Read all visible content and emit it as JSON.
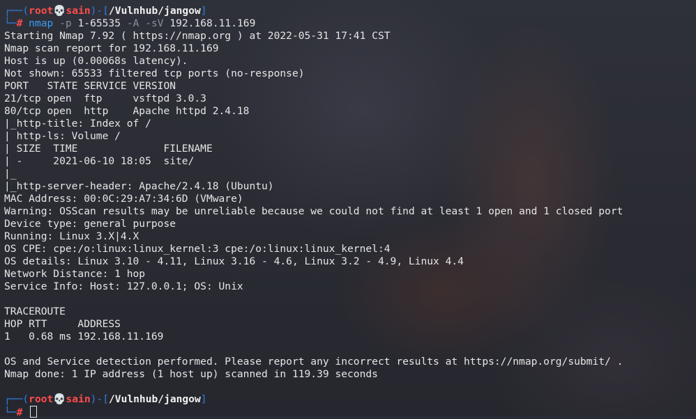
{
  "prompt": {
    "corner_top": "┌──(",
    "user": "root",
    "skull": "💀",
    "host": "sain",
    "mid": ")-[",
    "path": "/Vulnhub/jangow",
    "end": "]",
    "corner_bottom": "└─",
    "symbol": "#"
  },
  "command": {
    "program": "nmap",
    "flag_p": "-p",
    "port_range": "1-65535",
    "flag_A": "-A",
    "flag_sV": "-sV",
    "target": "192.168.11.169"
  },
  "output": [
    "Starting Nmap 7.92 ( https://nmap.org ) at 2022-05-31 17:41 CST",
    "Nmap scan report for 192.168.11.169",
    "Host is up (0.00068s latency).",
    "Not shown: 65533 filtered tcp ports (no-response)",
    "PORT   STATE SERVICE VERSION",
    "21/tcp open  ftp     vsftpd 3.0.3",
    "80/tcp open  http    Apache httpd 2.4.18",
    "|_http-title: Index of /",
    "| http-ls: Volume /",
    "| SIZE  TIME              FILENAME",
    "| -     2021-06-10 18:05  site/",
    "|_",
    "|_http-server-header: Apache/2.4.18 (Ubuntu)",
    "MAC Address: 00:0C:29:A7:34:6D (VMware)",
    "Warning: OSScan results may be unreliable because we could not find at least 1 open and 1 closed port",
    "Device type: general purpose",
    "Running: Linux 3.X|4.X",
    "OS CPE: cpe:/o:linux:linux_kernel:3 cpe:/o:linux:linux_kernel:4",
    "OS details: Linux 3.10 - 4.11, Linux 3.16 - 4.6, Linux 3.2 - 4.9, Linux 4.4",
    "Network Distance: 1 hop",
    "Service Info: Host: 127.0.0.1; OS: Unix",
    "",
    "TRACEROUTE",
    "HOP RTT     ADDRESS",
    "1   0.68 ms 192.168.11.169",
    "",
    "OS and Service detection performed. Please report any incorrect results at https://nmap.org/submit/ .",
    "Nmap done: 1 IP address (1 host up) scanned in 119.39 seconds",
    ""
  ]
}
